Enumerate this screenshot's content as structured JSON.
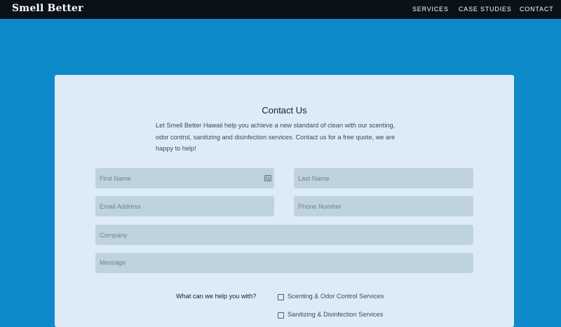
{
  "header": {
    "logo": "Smell Better",
    "nav": [
      "SERVICES",
      "CASE STUDIES",
      "CONTACT"
    ]
  },
  "form": {
    "title": "Contact Us",
    "intro": "Let Smell Better Hawaii help you achieve a new standard of clean with our scenting, odor control, sanitizing and disinfection services. Contact us for a free quote, we are happy to help!",
    "fields": {
      "first_name": "First Name",
      "last_name": "Last Name",
      "email": "Email Address",
      "phone": "Phone Number",
      "company": "Company",
      "message": "Message"
    },
    "help_label": "What can we help you with?",
    "options": [
      "Scenting & Odor Control Services",
      "Sanitizing & Disinfection Services"
    ]
  },
  "colors": {
    "page_bg": "#0e89c9",
    "header_bg": "#0b1118",
    "card_bg": "#ddebf6",
    "field_bg": "#bfd3de"
  },
  "icons": {
    "autofill": "contact-card-icon"
  }
}
